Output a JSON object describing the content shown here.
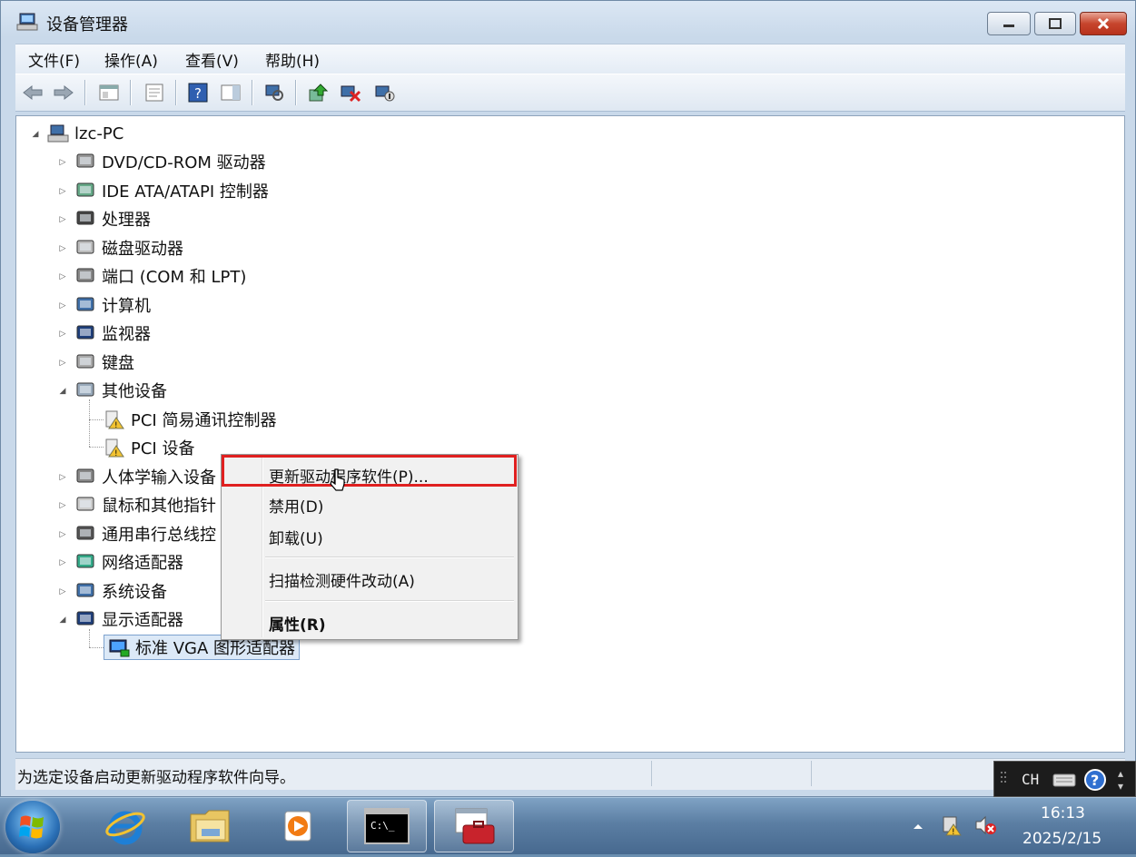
{
  "window": {
    "title": "设备管理器",
    "icon": "device-manager-icon"
  },
  "menu": [
    {
      "label": "文件(F)"
    },
    {
      "label": "操作(A)"
    },
    {
      "label": "查看(V)"
    },
    {
      "label": "帮助(H)"
    }
  ],
  "toolbar": {
    "icons": [
      "back-arrow-icon",
      "forward-arrow-icon",
      "show-hide-tree-icon",
      "properties-icon",
      "help-icon",
      "action-pane-icon",
      "scan-hardware-icon",
      "update-driver-icon",
      "uninstall-icon",
      "disable-device-icon"
    ]
  },
  "tree": {
    "root": {
      "label": "lzc-PC"
    },
    "categories": [
      {
        "label": "DVD/CD-ROM 驱动器",
        "icon": "dvd-drive-icon"
      },
      {
        "label": "IDE ATA/ATAPI 控制器",
        "icon": "ide-controller-icon"
      },
      {
        "label": "处理器",
        "icon": "processor-icon"
      },
      {
        "label": "磁盘驱动器",
        "icon": "disk-drive-icon"
      },
      {
        "label": "端口 (COM 和 LPT)",
        "icon": "port-icon"
      },
      {
        "label": "计算机",
        "icon": "computer-icon"
      },
      {
        "label": "监视器",
        "icon": "monitor-icon"
      },
      {
        "label": "键盘",
        "icon": "keyboard-icon"
      },
      {
        "label": "其他设备",
        "icon": "other-devices-icon"
      },
      {
        "label": "PCI 简易通讯控制器",
        "icon": "warning-device-icon"
      },
      {
        "label": "PCI 设备",
        "icon": "warning-device-icon"
      },
      {
        "label": "人体学输入设备",
        "icon": "hid-icon"
      },
      {
        "label": "鼠标和其他指针",
        "icon": "mouse-icon"
      },
      {
        "label": "通用串行总线控",
        "icon": "usb-icon"
      },
      {
        "label": "网络适配器",
        "icon": "network-adapter-icon"
      },
      {
        "label": "系统设备",
        "icon": "system-device-icon"
      },
      {
        "label": "显示适配器",
        "icon": "display-adapter-icon"
      },
      {
        "label": "标准 VGA 图形适配器",
        "icon": "vga-adapter-icon"
      }
    ]
  },
  "context_menu": {
    "items": [
      {
        "label": "更新驱动程序软件(P)..."
      },
      {
        "label": "禁用(D)"
      },
      {
        "label": "卸载(U)"
      },
      {
        "label": "扫描检测硬件改动(A)"
      },
      {
        "label": "属性(R)"
      }
    ]
  },
  "status": {
    "text": "为选定设备启动更新驱动程序软件向导。"
  },
  "langbar": {
    "text": "CH"
  },
  "taskbar": {
    "clock_time": "16:13",
    "clock_date": "2025/2/15"
  },
  "colors": {
    "highlight": "#e02020",
    "selection": "#dce9f7"
  }
}
